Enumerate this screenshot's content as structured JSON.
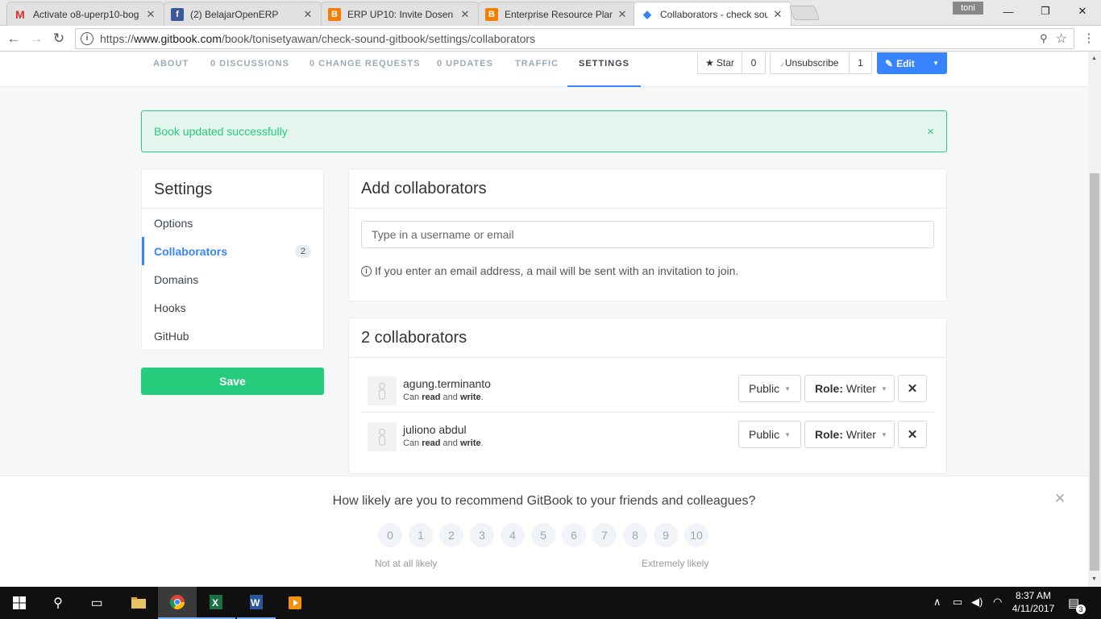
{
  "browser": {
    "tabs": [
      {
        "title": "Activate o8-uperp10-bog",
        "icon": "gmail-icon",
        "color": "#d93025"
      },
      {
        "title": "(2) BelajarOpenERP",
        "icon": "facebook-icon",
        "color": "#3b5998"
      },
      {
        "title": "ERP UP10: Invite Dosen n",
        "icon": "blogger-icon",
        "color": "#f57d00"
      },
      {
        "title": "Enterprise Resource Plan",
        "icon": "blogger-icon",
        "color": "#f57d00"
      },
      {
        "title": "Collaborators - check sou",
        "icon": "gitbook-icon",
        "color": "#3884ff"
      }
    ],
    "profile": "toni",
    "url_scheme": "https://",
    "url_host": "www.gitbook.com",
    "url_path": "/book/tonisetyawan/check-sound-gitbook/settings/collaborators"
  },
  "nav": {
    "tabs": [
      "ABOUT",
      "0 DISCUSSIONS",
      "0 CHANGE REQUESTS",
      "0 UPDATES",
      "TRAFFIC",
      "SETTINGS"
    ],
    "active_tab": "SETTINGS",
    "star_label": "Star",
    "star_count": "0",
    "unsubscribe_label": "Unsubscribe",
    "unsubscribe_count": "1",
    "edit_label": "Edit"
  },
  "alert": {
    "message": "Book updated successfully",
    "close": "×"
  },
  "sidebar": {
    "title": "Settings",
    "items": [
      {
        "label": "Options"
      },
      {
        "label": "Collaborators",
        "badge": "2"
      },
      {
        "label": "Domains"
      },
      {
        "label": "Hooks"
      },
      {
        "label": "GitHub"
      }
    ],
    "active": "Collaborators",
    "save_label": "Save"
  },
  "add": {
    "title": "Add collaborators",
    "placeholder": "Type in a username or email",
    "hint": "If you enter an email address, a mail will be sent with an invitation to join."
  },
  "collaborators": {
    "title": "2 collaborators",
    "list": [
      {
        "name": "agung.terminanto",
        "desc_prefix": "Can ",
        "read": "read",
        "desc_mid": " and ",
        "write": "write",
        "desc_end": ".",
        "visibility": "Public",
        "role_prefix": "Role:",
        "role": "Writer"
      },
      {
        "name": "juliono abdul",
        "desc_prefix": "Can ",
        "read": "read",
        "desc_mid": " and ",
        "write": "write",
        "desc_end": ".",
        "visibility": "Public",
        "role_prefix": "Role:",
        "role": "Writer"
      }
    ]
  },
  "survey": {
    "question": "How likely are you to recommend GitBook to your friends and colleagues?",
    "scores": [
      "0",
      "1",
      "2",
      "3",
      "4",
      "5",
      "6",
      "7",
      "8",
      "9",
      "10"
    ],
    "low_label": "Not at all likely",
    "high_label": "Extremely likely"
  },
  "taskbar": {
    "time": "8:37 AM",
    "date": "4/11/2017",
    "notifications": "3"
  }
}
